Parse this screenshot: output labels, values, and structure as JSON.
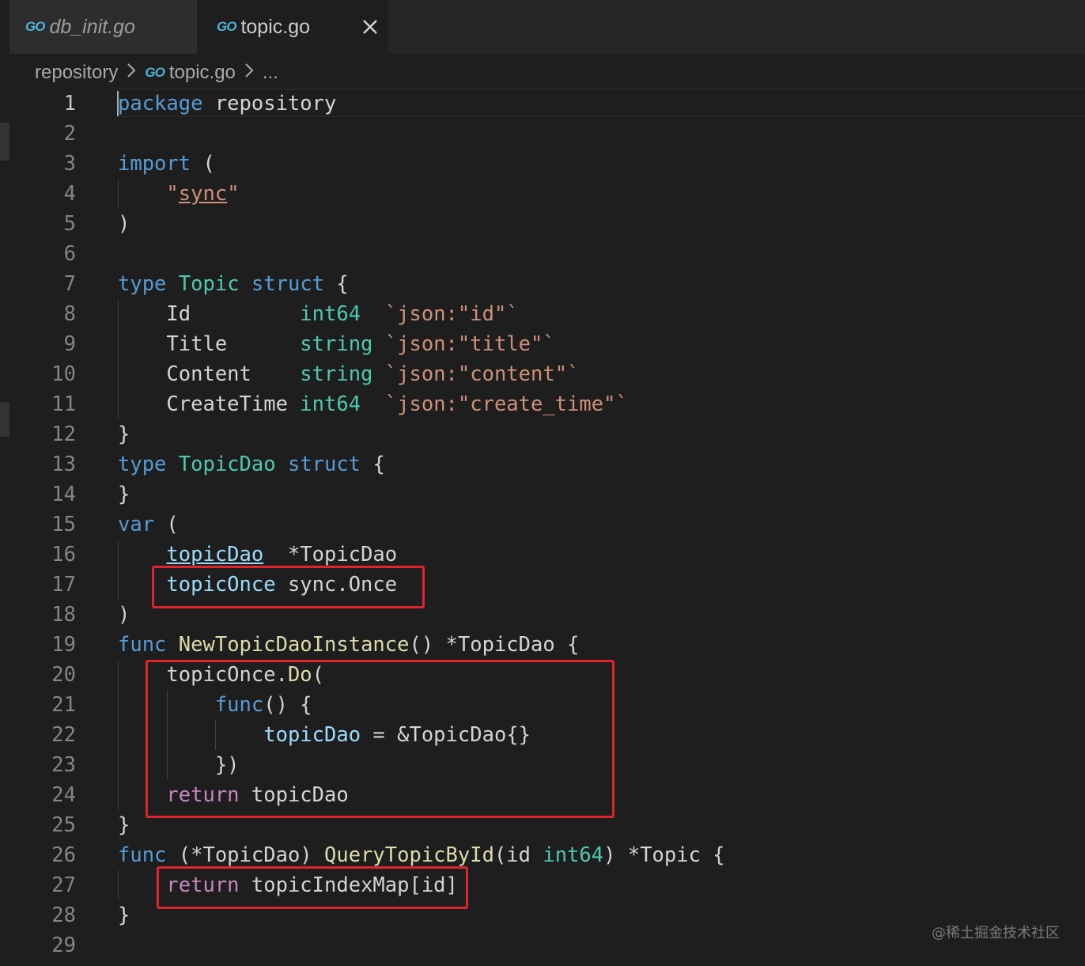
{
  "tabs": [
    {
      "label": "db_init.go",
      "icon": "go-file-icon",
      "active": false
    },
    {
      "label": "topic.go",
      "icon": "go-file-icon",
      "active": true
    }
  ],
  "breadcrumb": {
    "folder": "repository",
    "file": "topic.go",
    "more": "..."
  },
  "go_icon_text": "GO",
  "editor": {
    "language": "go",
    "current_line": 1,
    "lines": [
      {
        "n": "1",
        "html": "<span class=\"k\">package</span> repository"
      },
      {
        "n": "2",
        "html": ""
      },
      {
        "n": "3",
        "html": "<span class=\"k\">import</span> ("
      },
      {
        "n": "4",
        "html": "    <span class=\"s\">\"<span class=\"u\">sync</span>\"</span>"
      },
      {
        "n": "5",
        "html": ")"
      },
      {
        "n": "6",
        "html": ""
      },
      {
        "n": "7",
        "html": "<span class=\"k\">type</span> <span class=\"t\">Topic</span> <span class=\"k\">struct</span> {"
      },
      {
        "n": "8",
        "html": "    Id         <span class=\"t\">int64</span>  <span class=\"s\">`json:\"id\"`</span>"
      },
      {
        "n": "9",
        "html": "    Title      <span class=\"t\">string</span> <span class=\"s\">`json:\"title\"`</span>"
      },
      {
        "n": "10",
        "html": "    Content    <span class=\"t\">string</span> <span class=\"s\">`json:\"content\"`</span>"
      },
      {
        "n": "11",
        "html": "    CreateTime <span class=\"t\">int64</span>  <span class=\"s\">`json:\"create_time\"`</span>"
      },
      {
        "n": "12",
        "html": "}"
      },
      {
        "n": "13",
        "html": "<span class=\"k\">type</span> <span class=\"t\">TopicDao</span> <span class=\"k\">struct</span> {"
      },
      {
        "n": "14",
        "html": "}"
      },
      {
        "n": "15",
        "html": "<span class=\"k\">var</span> ("
      },
      {
        "n": "16",
        "html": "    <span class=\"v uv\">topicDao</span>  *TopicDao"
      },
      {
        "n": "17",
        "html": "    <span class=\"v\">topicOnce</span> sync.Once"
      },
      {
        "n": "18",
        "html": ")"
      },
      {
        "n": "19",
        "html": "<span class=\"k\">func</span> <span class=\"f\">NewTopicDaoInstance</span>() *TopicDao {"
      },
      {
        "n": "20",
        "html": "    topicOnce.<span class=\"f\">Do</span>("
      },
      {
        "n": "21",
        "html": "        <span class=\"k\">func</span>() {"
      },
      {
        "n": "22",
        "html": "            <span class=\"v\">topicDao</span> = &amp;TopicDao{}"
      },
      {
        "n": "23",
        "html": "        })"
      },
      {
        "n": "24",
        "html": "    <span class=\"r\">return</span> topicDao"
      },
      {
        "n": "25",
        "html": "}"
      },
      {
        "n": "26",
        "html": "<span class=\"k\">func</span> (*TopicDao) <span class=\"f\">QueryTopicById</span>(id <span class=\"t\">int64</span>) *Topic {"
      },
      {
        "n": "27",
        "html": "    <span class=\"r\">return</span> topicIndexMap[id]"
      },
      {
        "n": "28",
        "html": "}"
      },
      {
        "n": "29",
        "html": ""
      }
    ]
  },
  "highlight_boxes": [
    {
      "label": "topicOnce sync.Once"
    },
    {
      "label": "topicOnce.Do block"
    },
    {
      "label": "return topicIndexMap[id]"
    }
  ],
  "watermark": "@稀土掘金技术社区"
}
